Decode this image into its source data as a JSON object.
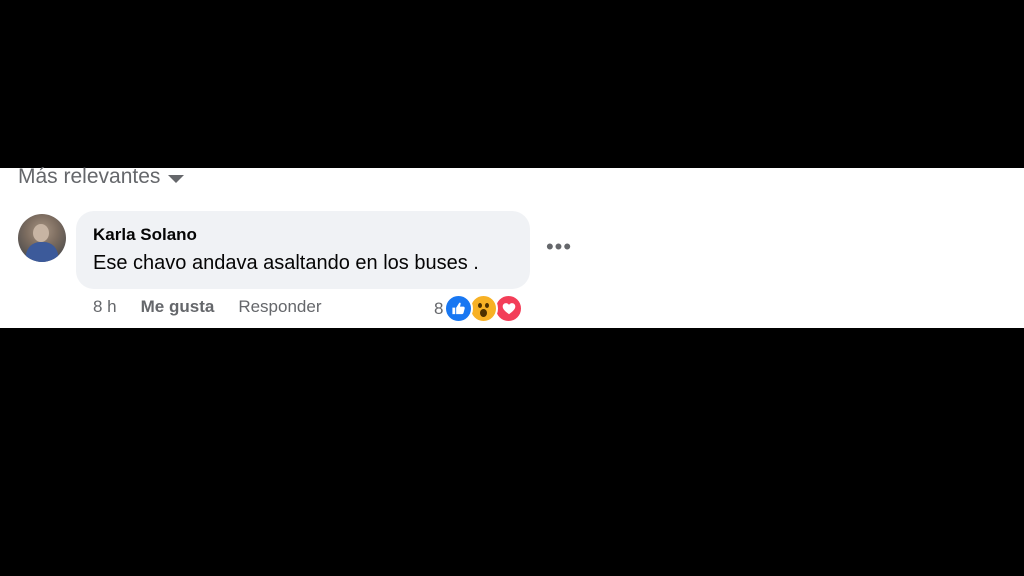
{
  "sort": {
    "label": "Más relevantes",
    "icon": "caret-down-icon"
  },
  "comment": {
    "author": "Karla Solano",
    "text": "Ese chavo andava asaltando en los buses .",
    "time": "8 h",
    "like_label": "Me gusta",
    "reply_label": "Responder",
    "more_label": "•••",
    "reaction_count": "8",
    "reactions": [
      "like-icon",
      "wow-icon",
      "love-icon"
    ]
  },
  "colors": {
    "bubble": "#f0f2f5",
    "secondary_text": "#65676b",
    "like_blue": "#1877f2",
    "wow_yellow": "#f7b125",
    "love_red": "#f33e58"
  }
}
